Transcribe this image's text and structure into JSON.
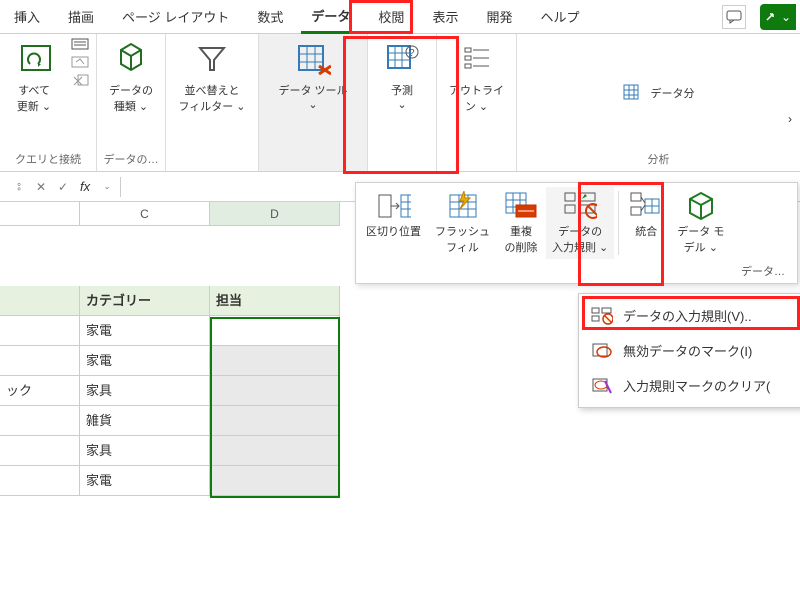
{
  "menubar": {
    "items": [
      "挿入",
      "描画",
      "ページ レイアウト",
      "数式",
      "データ",
      "校閲",
      "表示",
      "開発",
      "ヘルプ"
    ],
    "active_index": 4
  },
  "ribbon": {
    "groups": [
      {
        "label": "クエリと接続",
        "buttons": [
          {
            "label": "すべて\n更新 ⌄"
          }
        ]
      },
      {
        "label": "データの…",
        "buttons": [
          {
            "label": "データの\n種類 ⌄"
          }
        ]
      },
      {
        "label": "",
        "buttons": [
          {
            "label": "並べ替えと\nフィルター ⌄"
          }
        ]
      },
      {
        "label": "",
        "buttons": [
          {
            "label": "データ ツール\n⌄"
          }
        ],
        "highlighted": true
      },
      {
        "label": "",
        "buttons": [
          {
            "label": "予測\n⌄"
          }
        ]
      },
      {
        "label": "",
        "buttons": [
          {
            "label": "アウトライ\nン ⌄"
          }
        ]
      },
      {
        "label": "分析",
        "buttons": [
          {
            "label": "データ分"
          }
        ],
        "chevron": true
      }
    ]
  },
  "subribbon": {
    "label": "データ…",
    "buttons": [
      {
        "label": "区切り位置"
      },
      {
        "label": "フラッシュ\nフィル"
      },
      {
        "label": "重複\nの削除"
      },
      {
        "label": "データの\n入力規則 ⌄",
        "highlighted": true
      },
      {
        "label": "統合"
      },
      {
        "label": "データ モ\nデル ⌄"
      }
    ]
  },
  "dropdown": {
    "items": [
      {
        "label": "データの入力規則(V)..",
        "highlighted": true,
        "icon": "validation"
      },
      {
        "label": "無効データのマーク(I)",
        "icon": "circle-invalid"
      },
      {
        "label": "入力規則マークのクリア(",
        "icon": "clear-marks"
      }
    ]
  },
  "sheet": {
    "columns": [
      "C",
      "D"
    ],
    "headers": [
      "カテゴリー",
      "担当"
    ],
    "partial_left": [
      "",
      "ック",
      "",
      "",
      ""
    ],
    "rows": [
      [
        "家電",
        ""
      ],
      [
        "家電",
        ""
      ],
      [
        "家具",
        ""
      ],
      [
        "雑貨",
        ""
      ],
      [
        "家具",
        ""
      ],
      [
        "家電",
        ""
      ]
    ]
  },
  "formula_bar": {
    "cancel": "✕",
    "confirm": "✓",
    "fx": "fx",
    "dropdown": "⌄"
  }
}
